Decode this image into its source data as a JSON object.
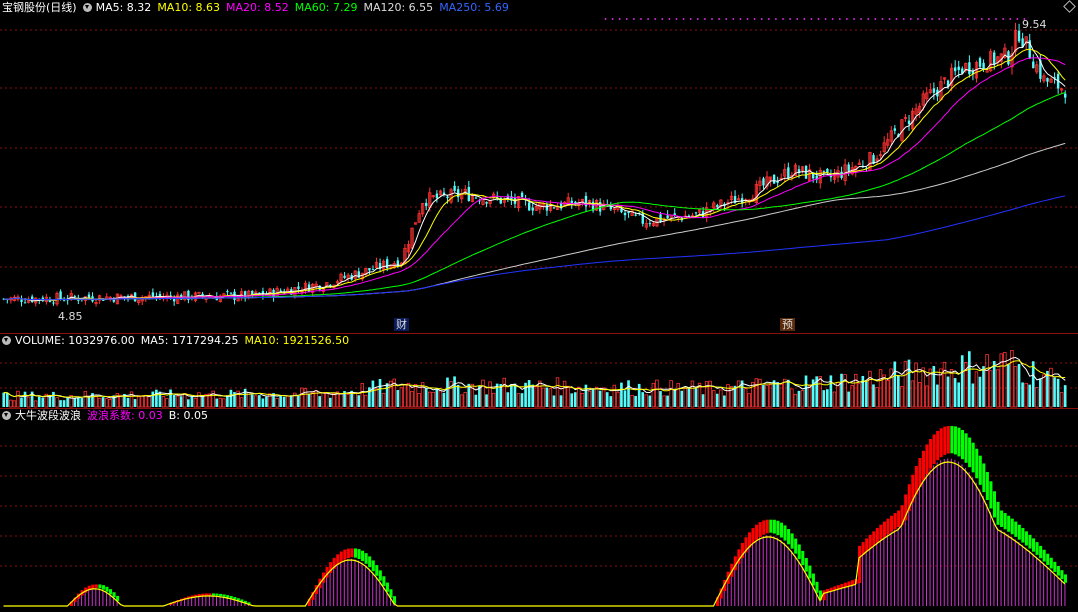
{
  "price_legend": {
    "name": "宝钢股份(日线)",
    "items": [
      {
        "label": "MA5: 8.32",
        "color": "#ffffff"
      },
      {
        "label": "MA10: 8.63",
        "color": "#ffff00"
      },
      {
        "label": "MA20: 8.52",
        "color": "#ff00ff"
      },
      {
        "label": "MA60: 7.29",
        "color": "#00ff00"
      },
      {
        "label": "MA120: 6.55",
        "color": "#dddddd"
      },
      {
        "label": "MA250: 5.69",
        "color": "#2222ff"
      }
    ]
  },
  "vol_legend": {
    "items": [
      {
        "label": "VOLUME: 1032976.00",
        "color": "#ffffff"
      },
      {
        "label": "MA5: 1717294.25",
        "color": "#ffffff"
      },
      {
        "label": "MA10: 1921526.50",
        "color": "#ffff00"
      }
    ]
  },
  "ind_legend": {
    "items": [
      {
        "label": "大牛波段波浪",
        "color": "#ffffff"
      },
      {
        "label": "波浪系数: 0.03",
        "color": "#ff00ff"
      },
      {
        "label": "B: 0.05",
        "color": "#ffffff"
      }
    ]
  },
  "annotations": {
    "high": "9.54",
    "low": "4.85",
    "event_cai": "财",
    "event_yu": "预"
  },
  "colors": {
    "up": "#ff3232",
    "down": "#54fcfc",
    "grid": "#8a1010",
    "ind_red": "#ff0000",
    "ind_green": "#00ff00",
    "ind_purple": "#cc33cc",
    "ind_line": "#ffff00"
  },
  "chart_data": [
    {
      "type": "candlestick",
      "title": "宝钢股份(日线)",
      "ylim": [
        4.6,
        9.7
      ],
      "annotations": {
        "max": 9.54,
        "min": 4.85
      },
      "close_keypoints": [
        {
          "i": 0,
          "v": 4.95
        },
        {
          "i": 30,
          "v": 4.98
        },
        {
          "i": 70,
          "v": 5.0
        },
        {
          "i": 90,
          "v": 5.2
        },
        {
          "i": 112,
          "v": 5.6
        },
        {
          "i": 118,
          "v": 6.6
        },
        {
          "i": 130,
          "v": 6.7
        },
        {
          "i": 150,
          "v": 6.5
        },
        {
          "i": 165,
          "v": 6.55
        },
        {
          "i": 180,
          "v": 6.25
        },
        {
          "i": 195,
          "v": 6.35
        },
        {
          "i": 210,
          "v": 6.7
        },
        {
          "i": 222,
          "v": 7.1
        },
        {
          "i": 232,
          "v": 6.95
        },
        {
          "i": 245,
          "v": 7.3
        },
        {
          "i": 260,
          "v": 8.3
        },
        {
          "i": 270,
          "v": 8.8
        },
        {
          "i": 283,
          "v": 9.0
        },
        {
          "i": 286,
          "v": 9.4
        },
        {
          "i": 293,
          "v": 8.6
        },
        {
          "i": 299,
          "v": 8.45
        }
      ]
    },
    {
      "type": "bar",
      "title": "VOLUME",
      "values_keypoints": [
        {
          "i": 0,
          "v": 0.45
        },
        {
          "i": 90,
          "v": 0.55
        },
        {
          "i": 112,
          "v": 0.9
        },
        {
          "i": 150,
          "v": 0.85
        },
        {
          "i": 200,
          "v": 0.75
        },
        {
          "i": 240,
          "v": 1.1
        },
        {
          "i": 265,
          "v": 1.6
        },
        {
          "i": 283,
          "v": 1.8
        },
        {
          "i": 299,
          "v": 1.0
        }
      ]
    },
    {
      "type": "bar",
      "title": "大牛波段波浪",
      "series": [
        {
          "name": "波浪系数",
          "value": 0.03
        },
        {
          "name": "B",
          "value": 0.05
        }
      ]
    }
  ]
}
